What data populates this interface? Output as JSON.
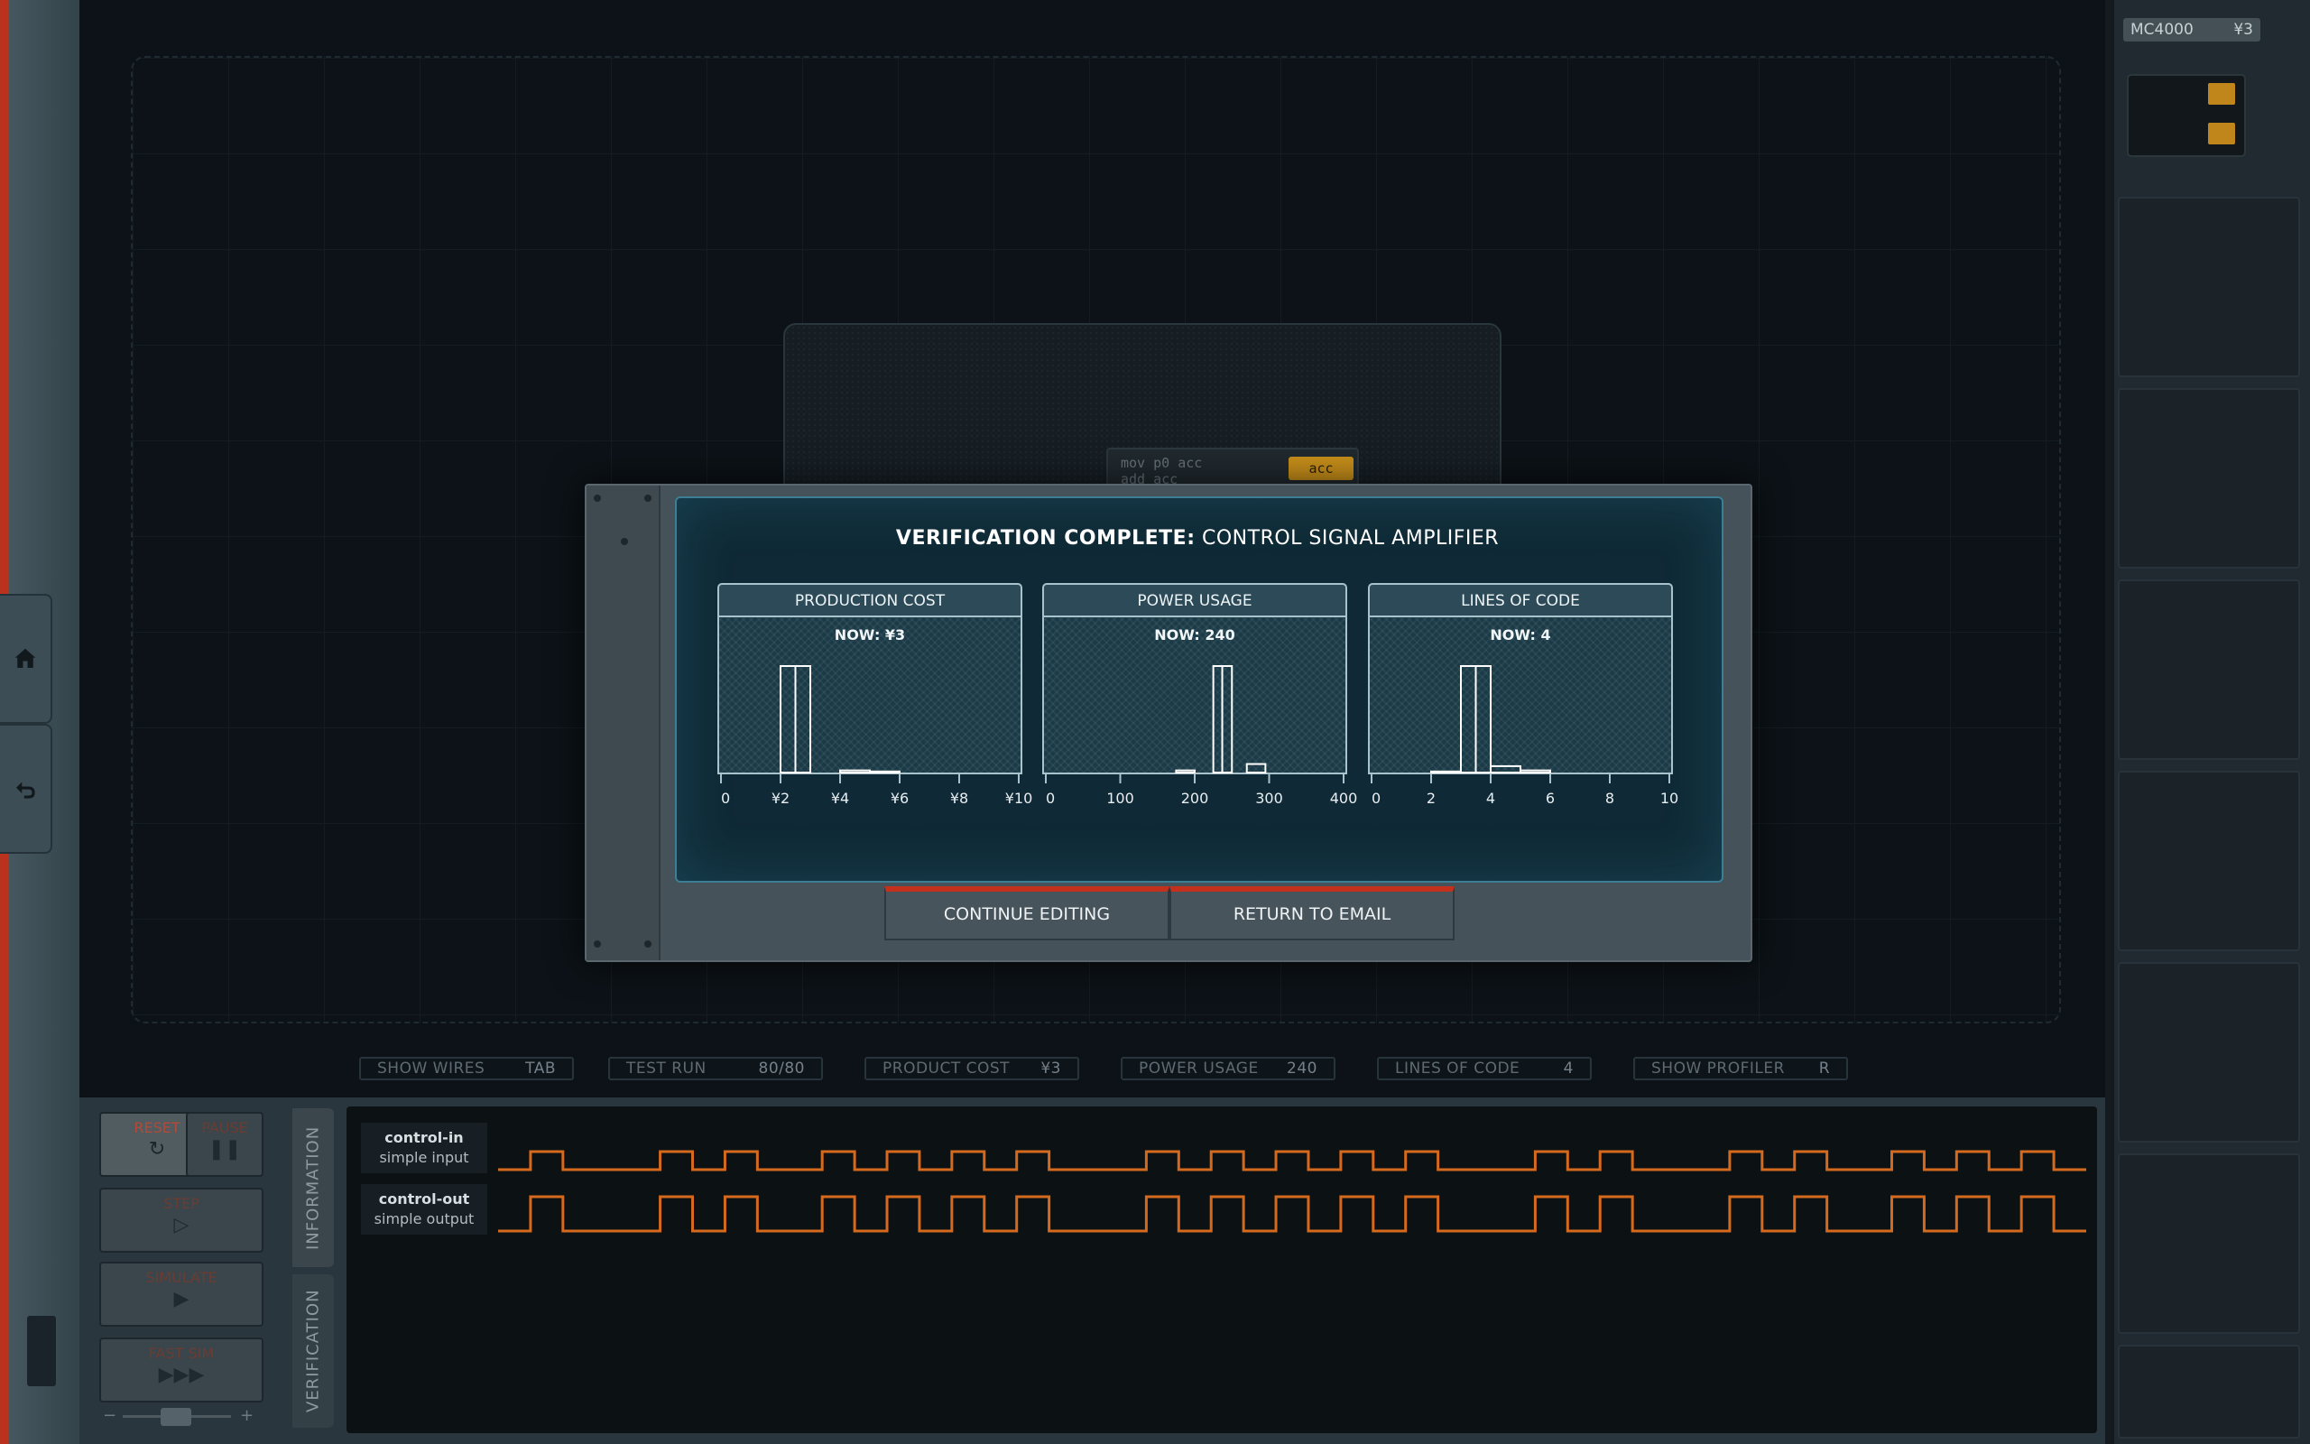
{
  "left_rail": {
    "home_icon": "home-icon",
    "undo_icon": "undo-icon"
  },
  "board": {
    "code_lines": [
      "mov p0 acc",
      "add acc"
    ],
    "acc_label": "acc"
  },
  "right_panel": {
    "chip_name": "MC4000",
    "chip_cost": "¥3"
  },
  "modal": {
    "title_bold": "VERIFICATION COMPLETE:",
    "title_rest": "CONTROL SIGNAL AMPLIFIER",
    "continue_label": "CONTINUE EDITING",
    "return_label": "RETURN TO EMAIL"
  },
  "chart_data": [
    {
      "type": "bar",
      "title": "PRODUCTION COST",
      "now_label": "NOW: ¥3",
      "xlim": [
        0,
        10
      ],
      "tick_values": [
        0,
        2,
        4,
        6,
        8,
        10
      ],
      "tick_labels": [
        "0",
        "¥2",
        "¥4",
        "¥6",
        "¥8",
        "¥10"
      ],
      "bins": [
        {
          "x0": 2.0,
          "x1": 2.5,
          "value": 100
        },
        {
          "x0": 2.5,
          "x1": 3.0,
          "value": 100
        },
        {
          "x0": 4.0,
          "x1": 5.0,
          "value": 2
        },
        {
          "x0": 5.0,
          "x1": 6.0,
          "value": 1
        }
      ],
      "current": 2.5
    },
    {
      "type": "bar",
      "title": "POWER USAGE",
      "now_label": "NOW: 240",
      "xlim": [
        0,
        400
      ],
      "tick_values": [
        0,
        100,
        200,
        300,
        400
      ],
      "tick_labels": [
        "0",
        "100",
        "200",
        "300",
        "400"
      ],
      "bins": [
        {
          "x0": 175,
          "x1": 200,
          "value": 2
        },
        {
          "x0": 225,
          "x1": 237,
          "value": 100
        },
        {
          "x0": 237,
          "x1": 250,
          "value": 100
        },
        {
          "x0": 270,
          "x1": 295,
          "value": 8
        }
      ],
      "current": 240
    },
    {
      "type": "bar",
      "title": "LINES OF CODE",
      "now_label": "NOW: 4",
      "xlim": [
        0,
        10
      ],
      "tick_values": [
        0,
        2,
        4,
        6,
        8,
        10
      ],
      "tick_labels": [
        "0",
        "2",
        "4",
        "6",
        "8",
        "10"
      ],
      "bins": [
        {
          "x0": 2.0,
          "x1": 3.0,
          "value": 1
        },
        {
          "x0": 3.0,
          "x1": 3.5,
          "value": 100
        },
        {
          "x0": 3.5,
          "x1": 4.0,
          "value": 100
        },
        {
          "x0": 4.0,
          "x1": 5.0,
          "value": 6
        },
        {
          "x0": 5.0,
          "x1": 6.0,
          "value": 2
        }
      ],
      "current": 3.5
    }
  ],
  "status_bar": [
    {
      "label": "SHOW WIRES",
      "value": "TAB"
    },
    {
      "label": "TEST RUN",
      "value": "80/80"
    },
    {
      "label": "PRODUCT COST",
      "value": "¥3"
    },
    {
      "label": "POWER USAGE",
      "value": "240"
    },
    {
      "label": "LINES OF CODE",
      "value": "4"
    },
    {
      "label": "SHOW PROFILER",
      "value": "R"
    }
  ],
  "controls": {
    "reset_label": "RESET",
    "pause_label": "PAUSE",
    "step_label": "STEP",
    "simulate_label": "SIMULATE",
    "fast_label": "FAST SIM",
    "zoom_minus": "−",
    "zoom_plus": "+"
  },
  "side_tabs": [
    "INFORMATION",
    "VERIFICATION"
  ],
  "signals": [
    {
      "name": "control-in",
      "type": "simple input",
      "levels": [
        0,
        1,
        0,
        0,
        0,
        1,
        0,
        1,
        0,
        0,
        1,
        0,
        1,
        0,
        1,
        0,
        1,
        0,
        0,
        0,
        1,
        0,
        1,
        0,
        1,
        0,
        1,
        0,
        1,
        0,
        0,
        0,
        1,
        0,
        1,
        0,
        0,
        0,
        1,
        0,
        1,
        0,
        0,
        1,
        0,
        1,
        0,
        1,
        0
      ]
    },
    {
      "name": "control-out",
      "type": "simple output",
      "levels": [
        0,
        1,
        0,
        0,
        0,
        1,
        0,
        1,
        0,
        0,
        1,
        0,
        1,
        0,
        1,
        0,
        1,
        0,
        0,
        0,
        1,
        0,
        1,
        0,
        1,
        0,
        1,
        0,
        1,
        0,
        0,
        0,
        1,
        0,
        1,
        0,
        0,
        0,
        1,
        0,
        1,
        0,
        0,
        1,
        0,
        1,
        0,
        1,
        0
      ]
    }
  ],
  "colors": {
    "accent": "#c3301c",
    "signal": "#d56a1e",
    "panel_border": "#a9c3cd",
    "chip_gold": "#c0861c"
  }
}
